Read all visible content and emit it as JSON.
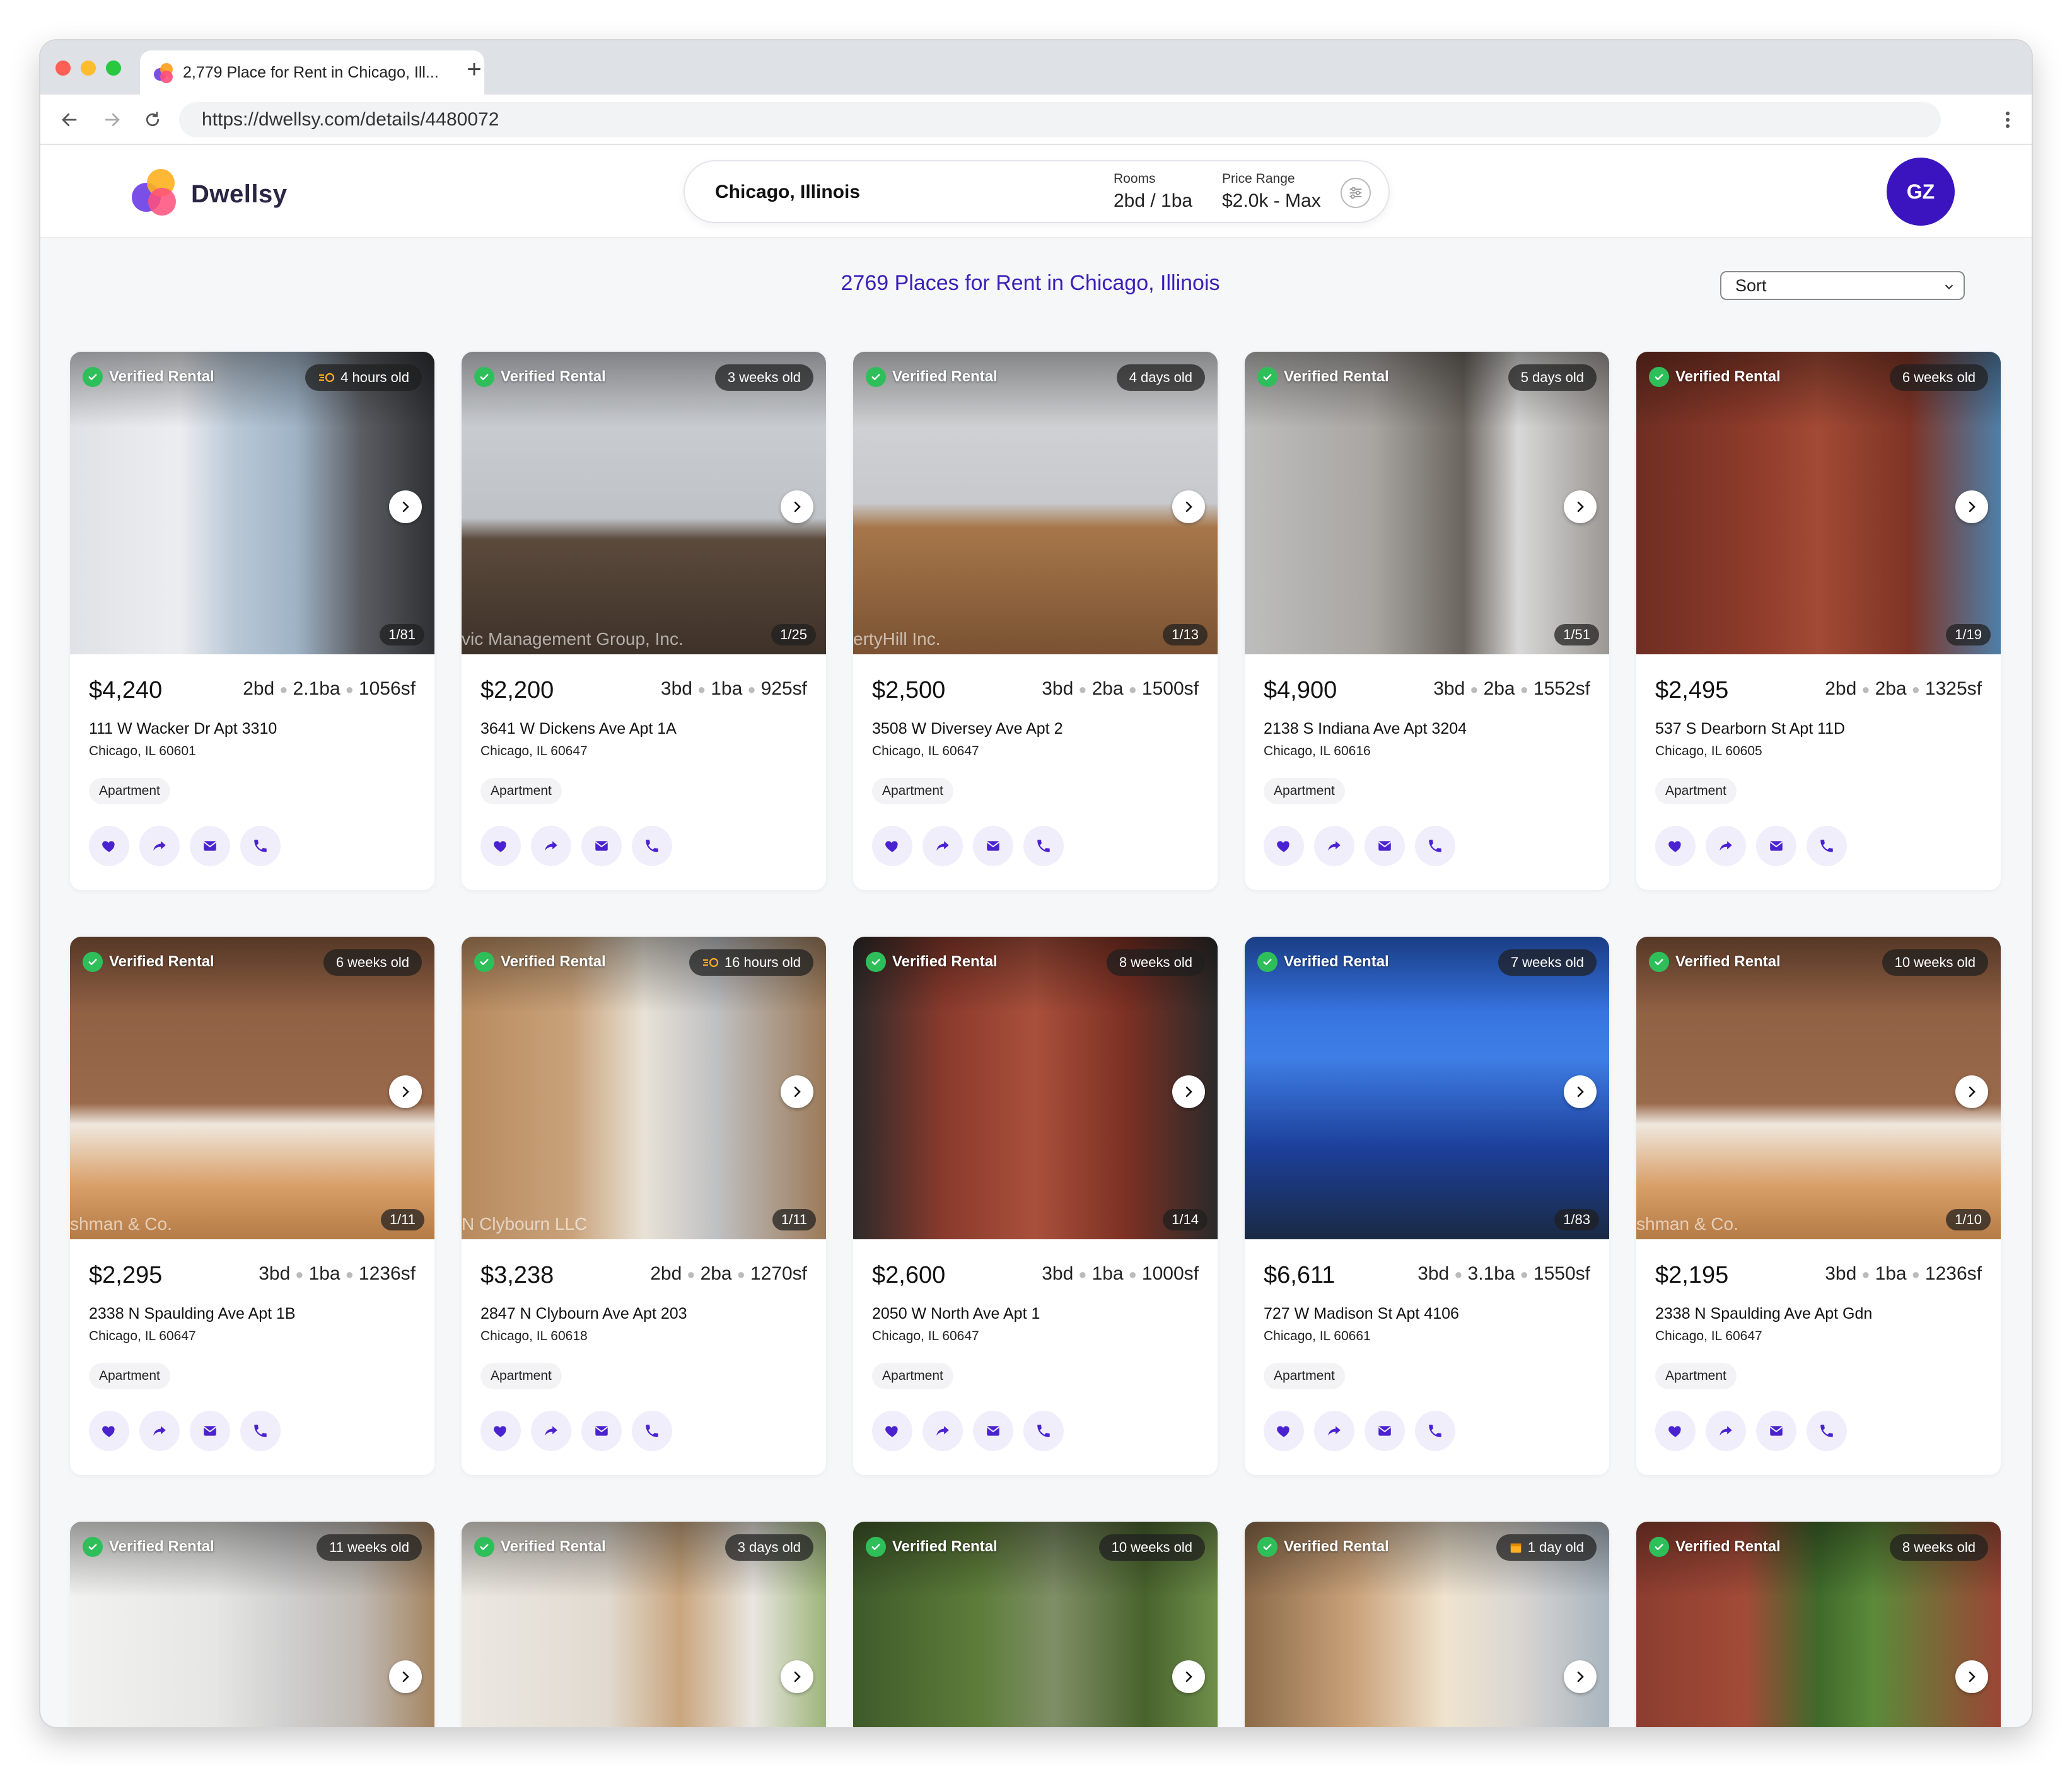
{
  "browser": {
    "tab_title": "2,779 Place for Rent in Chicago, Ill...",
    "new_tab_label": "+",
    "url": "https://dwellsy.com/details/4480072"
  },
  "header": {
    "brand": "Dwellsy",
    "location": "Chicago, Illinois",
    "rooms_label": "Rooms",
    "rooms_value": "2bd / 1ba",
    "price_label": "Price Range",
    "price_value": "$2.0k - Max",
    "avatar_initials": "GZ"
  },
  "results": {
    "title": "2769 Places for Rent in Chicago, Illinois",
    "sort_label": "Sort"
  },
  "colors": {
    "accent": "#3b1fb8",
    "avatar": "#3b14bf",
    "verified": "#2fbf5a",
    "action_bg": "#f0eefb"
  },
  "listings": [
    {
      "verified": "Verified Rental",
      "age": "4 hours old",
      "age_icon": "new-listing-icon",
      "photos": "1/81",
      "price": "$4,240",
      "beds": "2bd",
      "baths": "2.1ba",
      "sqft": "1056sf",
      "street": "111 W Wacker Dr Apt 3310",
      "city": "Chicago, IL 60601",
      "type": "Apartment",
      "watermark": "",
      "scene": "kitchen-view"
    },
    {
      "verified": "Verified Rental",
      "age": "3 weeks old",
      "age_icon": "",
      "photos": "1/25",
      "price": "$2,200",
      "beds": "3bd",
      "baths": "1ba",
      "sqft": "925sf",
      "street": "3641 W Dickens Ave Apt 1A",
      "city": "Chicago, IL 60647",
      "type": "Apartment",
      "watermark": "vic Management Group, Inc.",
      "scene": "empty-room"
    },
    {
      "verified": "Verified Rental",
      "age": "4 days old",
      "age_icon": "",
      "photos": "1/13",
      "price": "$2,500",
      "beds": "3bd",
      "baths": "2ba",
      "sqft": "1500sf",
      "street": "3508 W Diversey Ave Apt 2",
      "city": "Chicago, IL 60647",
      "type": "Apartment",
      "watermark": "ertyHill Inc.",
      "scene": "wood-room"
    },
    {
      "verified": "Verified Rental",
      "age": "5 days old",
      "age_icon": "",
      "photos": "1/51",
      "price": "$4,900",
      "beds": "3bd",
      "baths": "2ba",
      "sqft": "1552sf",
      "street": "2138 S Indiana Ave Apt 3204",
      "city": "Chicago, IL 60616",
      "type": "Apartment",
      "watermark": "",
      "scene": "kitchen-dark"
    },
    {
      "verified": "Verified Rental",
      "age": "6 weeks old",
      "age_icon": "",
      "photos": "1/19",
      "price": "$2,495",
      "beds": "2bd",
      "baths": "2ba",
      "sqft": "1325sf",
      "street": "537 S Dearborn St Apt 11D",
      "city": "Chicago, IL 60605",
      "type": "Apartment",
      "watermark": "",
      "scene": "brick-tower"
    },
    {
      "verified": "Verified Rental",
      "age": "6 weeks old",
      "age_icon": "",
      "photos": "1/11",
      "price": "$2,295",
      "beds": "3bd",
      "baths": "1ba",
      "sqft": "1236sf",
      "street": "2338 N Spaulding Ave Apt 1B",
      "city": "Chicago, IL 60647",
      "type": "Apartment",
      "watermark": "shman & Co.",
      "scene": "brick-wall"
    },
    {
      "verified": "Verified Rental",
      "age": "16 hours old",
      "age_icon": "new-listing-icon",
      "photos": "1/11",
      "price": "$3,238",
      "beds": "2bd",
      "baths": "2ba",
      "sqft": "1270sf",
      "street": "2847 N Clybourn Ave Apt 203",
      "city": "Chicago, IL 60618",
      "type": "Apartment",
      "watermark": "N Clybourn LLC",
      "scene": "kitchen-wood"
    },
    {
      "verified": "Verified Rental",
      "age": "8 weeks old",
      "age_icon": "",
      "photos": "1/14",
      "price": "$2,600",
      "beds": "3bd",
      "baths": "1ba",
      "sqft": "1000sf",
      "street": "2050 W North Ave Apt 1",
      "city": "Chicago, IL 60647",
      "type": "Apartment",
      "watermark": "",
      "scene": "brick-facade"
    },
    {
      "verified": "Verified Rental",
      "age": "7 weeks old",
      "age_icon": "",
      "photos": "1/83",
      "price": "$6,611",
      "beds": "3bd",
      "baths": "3.1ba",
      "sqft": "1550sf",
      "street": "727 W Madison St Apt 4106",
      "city": "Chicago, IL 60661",
      "type": "Apartment",
      "watermark": "",
      "scene": "glass-tower"
    },
    {
      "verified": "Verified Rental",
      "age": "10 weeks old",
      "age_icon": "",
      "photos": "1/10",
      "price": "$2,195",
      "beds": "3bd",
      "baths": "1ba",
      "sqft": "1236sf",
      "street": "2338 N Spaulding Ave Apt Gdn",
      "city": "Chicago, IL 60647",
      "type": "Apartment",
      "watermark": "shman & Co.",
      "scene": "brick-wall"
    },
    {
      "verified": "Verified Rental",
      "age": "11 weeks old",
      "age_icon": "",
      "photos": "",
      "price": "",
      "beds": "",
      "baths": "",
      "sqft": "",
      "street": "",
      "city": "",
      "type": "",
      "watermark": "",
      "scene": "living-white"
    },
    {
      "verified": "Verified Rental",
      "age": "3 days old",
      "age_icon": "",
      "photos": "",
      "price": "",
      "beds": "",
      "baths": "",
      "sqft": "",
      "street": "",
      "city": "",
      "type": "",
      "watermark": "",
      "scene": "dining"
    },
    {
      "verified": "Verified Rental",
      "age": "10 weeks old",
      "age_icon": "",
      "photos": "",
      "price": "",
      "beds": "",
      "baths": "",
      "sqft": "",
      "street": "",
      "city": "",
      "type": "",
      "watermark": "",
      "scene": "tree-street"
    },
    {
      "verified": "Verified Rental",
      "age": "1 day old",
      "age_icon": "calendar-icon",
      "photos": "",
      "price": "",
      "beds": "",
      "baths": "",
      "sqft": "",
      "street": "",
      "city": "",
      "type": "",
      "watermark": "",
      "scene": "kitchen-bright"
    },
    {
      "verified": "Verified Rental",
      "age": "8 weeks old",
      "age_icon": "",
      "photos": "",
      "price": "",
      "beds": "",
      "baths": "",
      "sqft": "",
      "street": "",
      "city": "",
      "type": "",
      "watermark": "",
      "scene": "brick-tree"
    }
  ]
}
